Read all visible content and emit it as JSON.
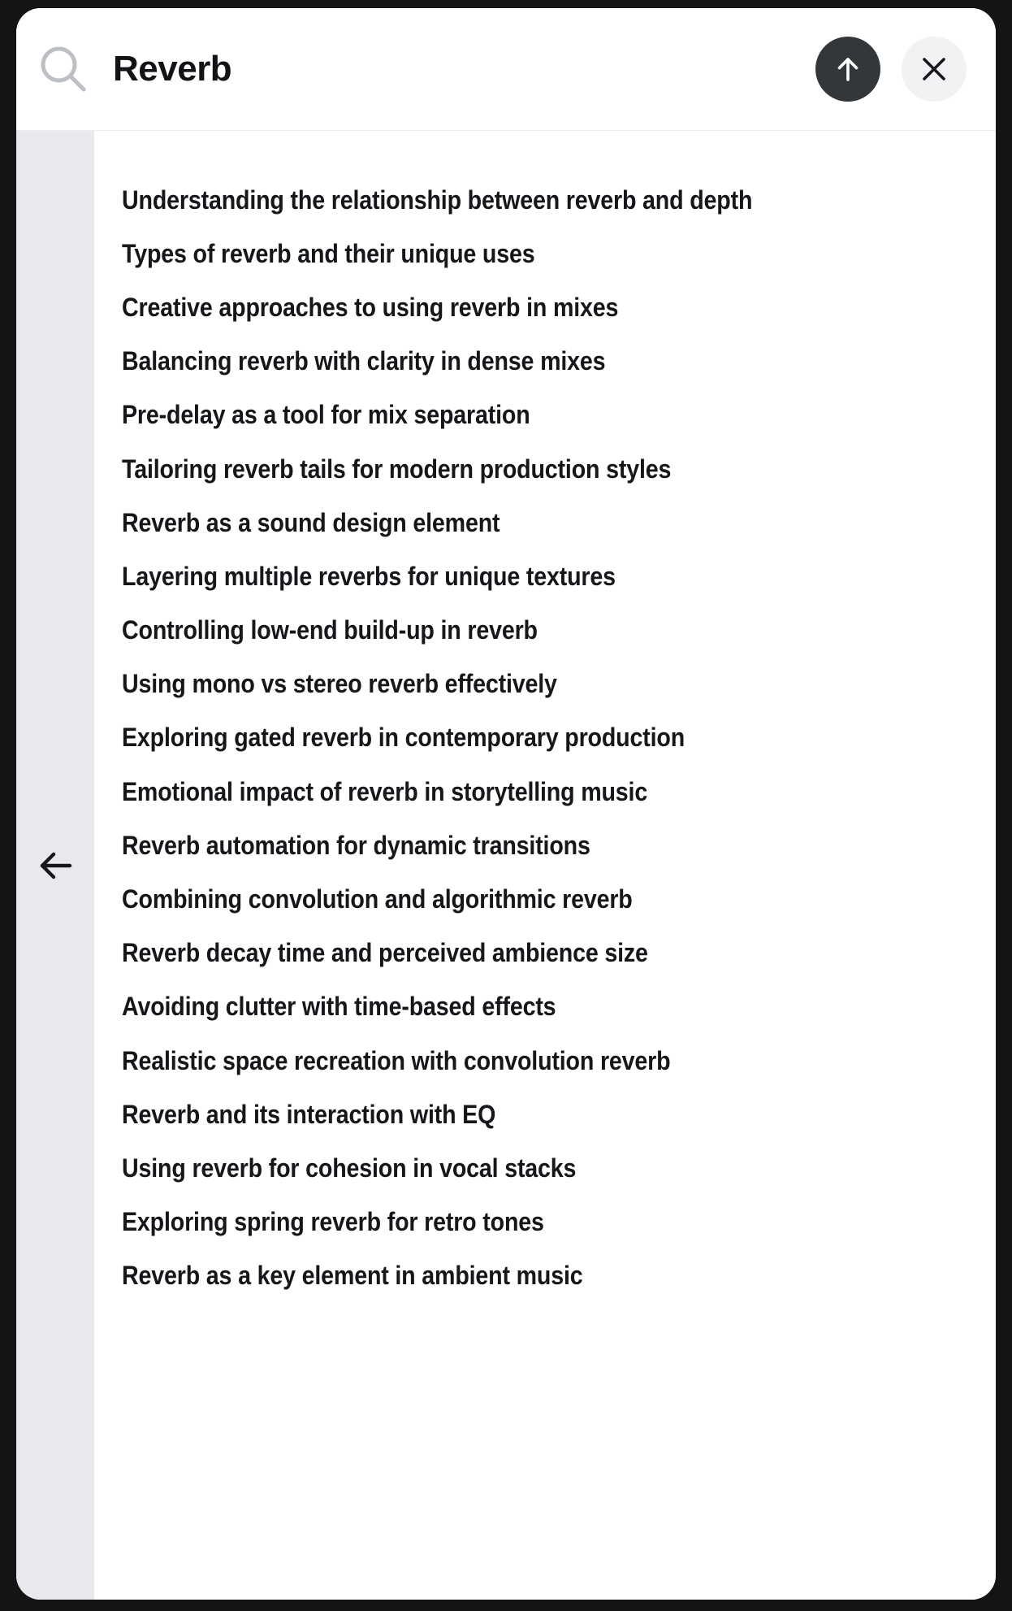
{
  "window": {
    "background_color": "#141414",
    "card_background": "#ffffff"
  },
  "search": {
    "icon": "search-icon",
    "value": "Reverb",
    "placeholder": "Search",
    "submit_button": {
      "icon": "arrow-up-icon",
      "label": "Submit search",
      "background_color": "#33373a",
      "icon_color": "#ffffff"
    },
    "close_button": {
      "icon": "close-x-icon",
      "label": "Close search",
      "background_color": "#f1f2f4",
      "icon_color": "#15171a"
    }
  },
  "rail": {
    "background_color": "#e8e9ec",
    "back_button": {
      "icon": "arrow-left-icon",
      "label": "Back",
      "icon_color": "#15171a"
    }
  },
  "suggestions": {
    "text_color": "#15171a",
    "items": [
      {
        "label": "Understanding the relationship between reverb and depth"
      },
      {
        "label": "Types of reverb and their unique uses"
      },
      {
        "label": "Creative approaches to using reverb in mixes"
      },
      {
        "label": "Balancing reverb with clarity in dense mixes"
      },
      {
        "label": "Pre-delay as a tool for mix separation"
      },
      {
        "label": "Tailoring reverb tails for modern production styles"
      },
      {
        "label": "Reverb as a sound design element"
      },
      {
        "label": "Layering multiple reverbs for unique textures"
      },
      {
        "label": "Controlling low-end build-up in reverb"
      },
      {
        "label": "Using mono vs stereo reverb effectively"
      },
      {
        "label": "Exploring gated reverb in contemporary production"
      },
      {
        "label": "Emotional impact of reverb in storytelling music"
      },
      {
        "label": "Reverb automation for dynamic transitions"
      },
      {
        "label": "Combining convolution and algorithmic reverb"
      },
      {
        "label": "Reverb decay time and perceived ambience size"
      },
      {
        "label": "Avoiding clutter with time-based effects"
      },
      {
        "label": "Realistic space recreation with convolution reverb"
      },
      {
        "label": "Reverb and its interaction with EQ"
      },
      {
        "label": "Using reverb for cohesion in vocal stacks"
      },
      {
        "label": "Exploring spring reverb for retro tones"
      },
      {
        "label": "Reverb as a key element in ambient music"
      }
    ]
  }
}
